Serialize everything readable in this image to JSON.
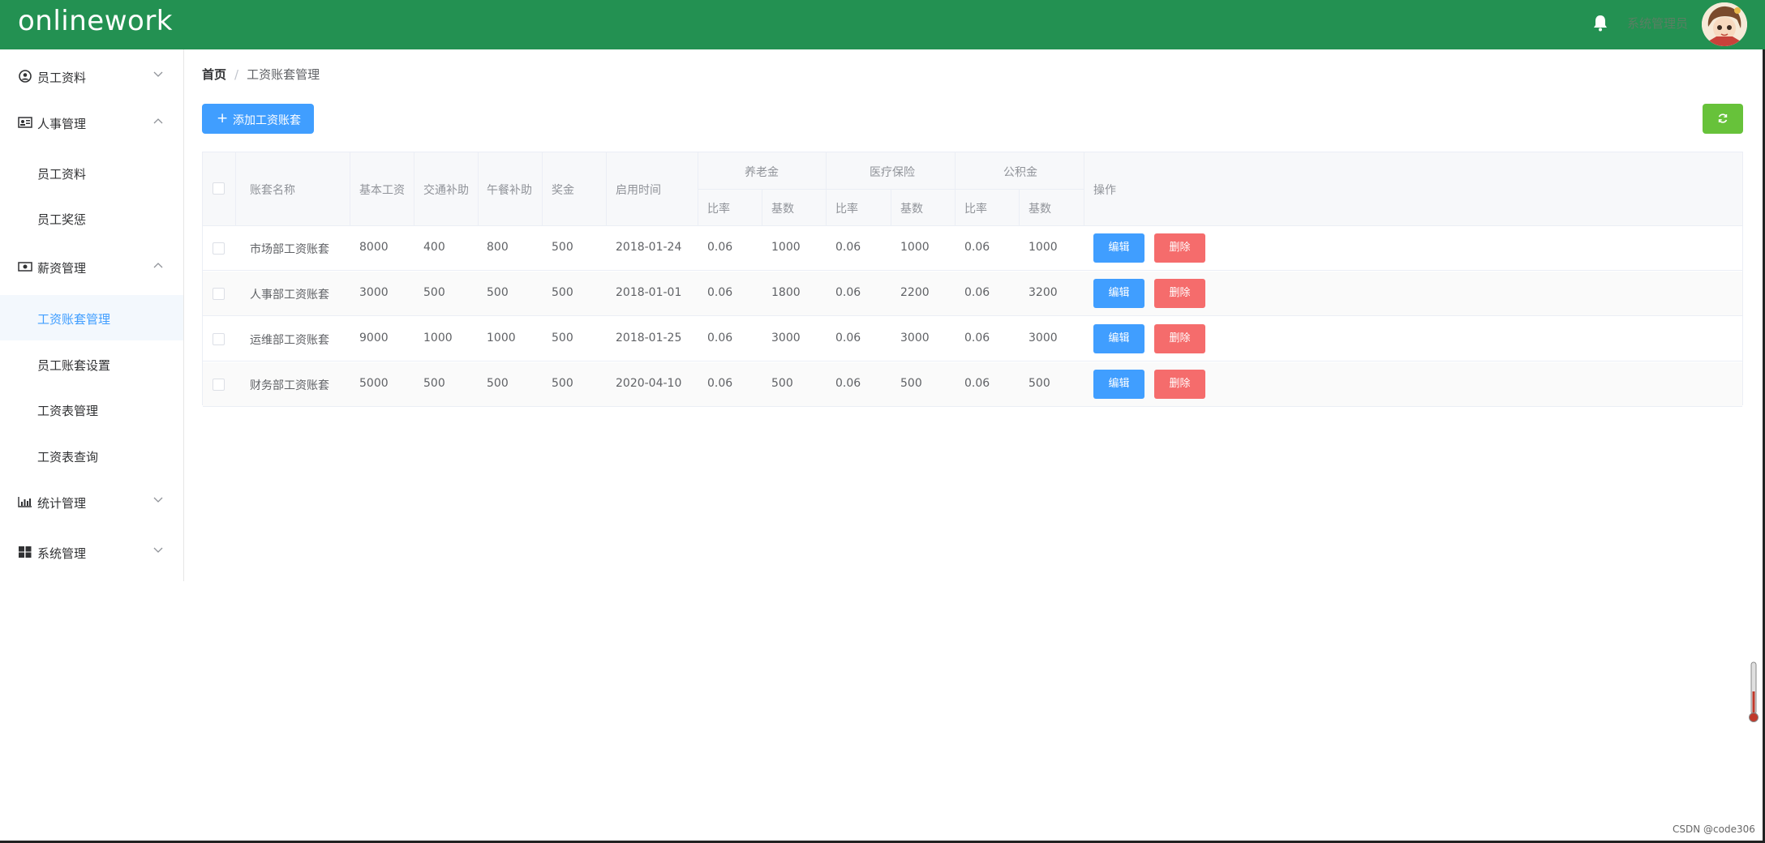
{
  "header": {
    "logo": "onlinework",
    "username": "系统管理员"
  },
  "sidebar": {
    "menus": [
      {
        "label": "员工资料",
        "icon": "user-circle-icon"
      },
      {
        "label": "人事管理",
        "icon": "id-card-icon"
      },
      {
        "label": "薪资管理",
        "icon": "money-icon"
      },
      {
        "label": "统计管理",
        "icon": "bar-chart-icon"
      },
      {
        "label": "系统管理",
        "icon": "windows-icon"
      }
    ],
    "sub_personnel": [
      "员工资料",
      "员工奖惩"
    ],
    "sub_salary": [
      "工资账套管理",
      "员工账套设置",
      "工资表管理",
      "工资表查询"
    ]
  },
  "breadcrumb": {
    "home": "首页",
    "separator": "/",
    "current": "工资账套管理"
  },
  "toolbar": {
    "add_label": "添加工资账套"
  },
  "table": {
    "headers": {
      "name": "账套名称",
      "base": "基本工资",
      "traffic": "交通补助",
      "lunch": "午餐补助",
      "bonus": "奖金",
      "start": "启用时间",
      "pension": "养老金",
      "medical": "医疗保险",
      "fund": "公积金",
      "ratio": "比率",
      "basenum": "基数",
      "ops": "操作"
    },
    "rows": [
      {
        "name": "市场部工资账套",
        "base": "8000",
        "traffic": "400",
        "lunch": "800",
        "bonus": "500",
        "start": "2018-01-24",
        "pr": "0.06",
        "pb": "1000",
        "mr": "0.06",
        "mb": "1000",
        "fr": "0.06",
        "fb": "1000"
      },
      {
        "name": "人事部工资账套",
        "base": "3000",
        "traffic": "500",
        "lunch": "500",
        "bonus": "500",
        "start": "2018-01-01",
        "pr": "0.06",
        "pb": "1800",
        "mr": "0.06",
        "mb": "2200",
        "fr": "0.06",
        "fb": "3200"
      },
      {
        "name": "运维部工资账套",
        "base": "9000",
        "traffic": "1000",
        "lunch": "1000",
        "bonus": "500",
        "start": "2018-01-25",
        "pr": "0.06",
        "pb": "3000",
        "mr": "0.06",
        "mb": "3000",
        "fr": "0.06",
        "fb": "3000"
      },
      {
        "name": "财务部工资账套",
        "base": "5000",
        "traffic": "500",
        "lunch": "500",
        "bonus": "500",
        "start": "2020-04-10",
        "pr": "0.06",
        "pb": "500",
        "mr": "0.06",
        "mb": "500",
        "fr": "0.06",
        "fb": "500"
      }
    ],
    "edit_label": "编辑",
    "delete_label": "删除"
  },
  "watermark": "CSDN @code306",
  "colors": {
    "header": "#239152",
    "primary": "#409eff",
    "success": "#67c23a",
    "danger": "#f56c6c"
  }
}
